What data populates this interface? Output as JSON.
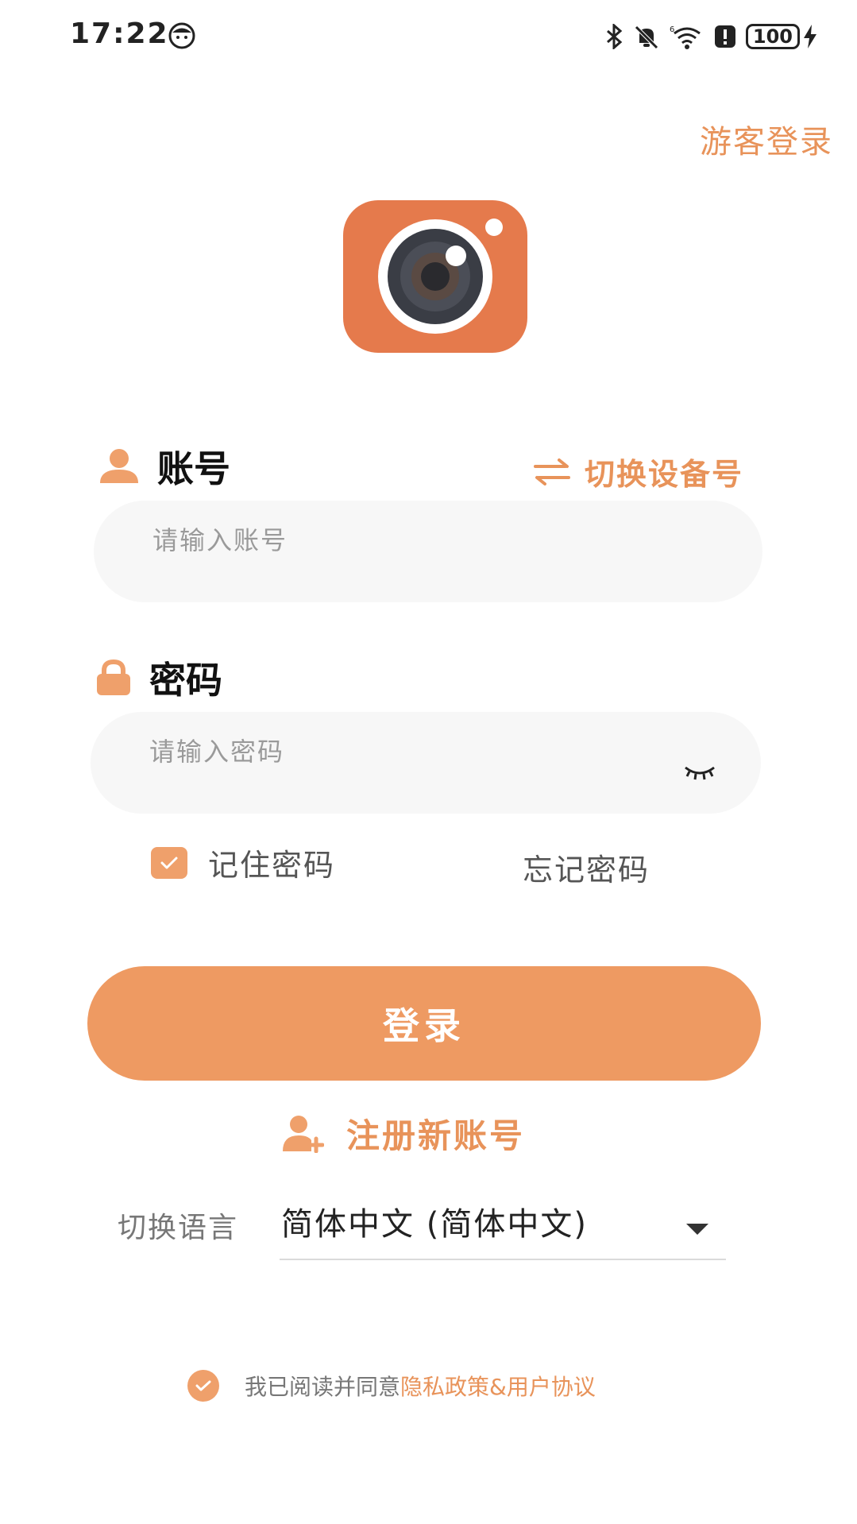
{
  "status_bar": {
    "time": "17:22",
    "battery": "100",
    "icons": [
      "bluetooth-icon",
      "bell-muted-icon",
      "wifi-icon",
      "alert-icon",
      "battery-icon",
      "charging-icon"
    ]
  },
  "header": {
    "guest_login": "游客登录"
  },
  "logo": {
    "icon": "camera-logo-icon"
  },
  "account": {
    "label": "账号",
    "switch_label": "切换设备号",
    "placeholder": "请输入账号"
  },
  "password": {
    "label": "密码",
    "placeholder": "请输入密码"
  },
  "options": {
    "remember_label": "记住密码",
    "remember_checked": true,
    "forgot_label": "忘记密码"
  },
  "login_button": "登录",
  "register_label": "注册新账号",
  "language": {
    "label": "切换语言",
    "selected": "简体中文 (简体中文)"
  },
  "agreement": {
    "text": "我已阅读并同意",
    "link": "隐私政策&用户协议",
    "checked": true
  },
  "colors": {
    "accent": "#E8935A",
    "button": "#EE9A62",
    "logo": "#E57A4C",
    "input_bg": "#F7F7F7"
  }
}
